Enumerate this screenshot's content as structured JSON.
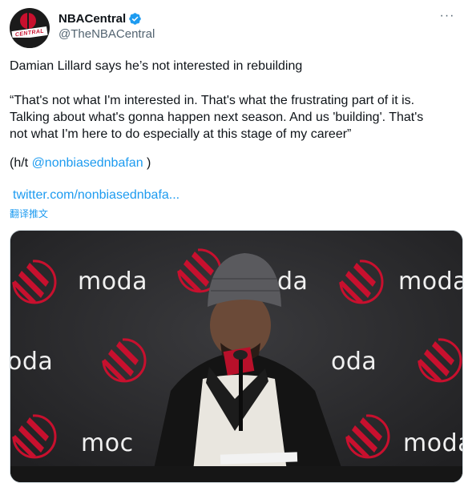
{
  "account": {
    "display_name": "NBACentral",
    "handle": "@TheNBACentral",
    "verified": true,
    "avatar_text": "CENTRAL"
  },
  "icons": {
    "verified": "verified-badge-icon",
    "more": "more-options-icon"
  },
  "more_label": "···",
  "tweet": {
    "headline": "Damian Lillard says he’s not interested in rebuilding",
    "quote_lines": [
      "“That's not what I'm interested in. That's what the frustrating part of it is.",
      "Talking about what's gonna happen next season. And us 'building'. That's",
      "not what I'm here to do especially at this stage of my career”"
    ],
    "ht_prefix": "(h/t ",
    "ht_mention": "@nonbiasednbafan",
    "ht_suffix": " )",
    "link_text": "twitter.com/nonbiasednbafa...",
    "translate_label": "翻译推文"
  },
  "media": {
    "backdrop_logo_texts": [
      "moda",
      "da",
      "moda",
      "oda",
      "oda",
      "moda",
      "moc",
      "moda"
    ],
    "description": "press-conference-video"
  },
  "colors": {
    "link": "#1d9bf0",
    "text": "#0f1419",
    "muted": "#536471",
    "blazers_red": "#c8102e"
  }
}
